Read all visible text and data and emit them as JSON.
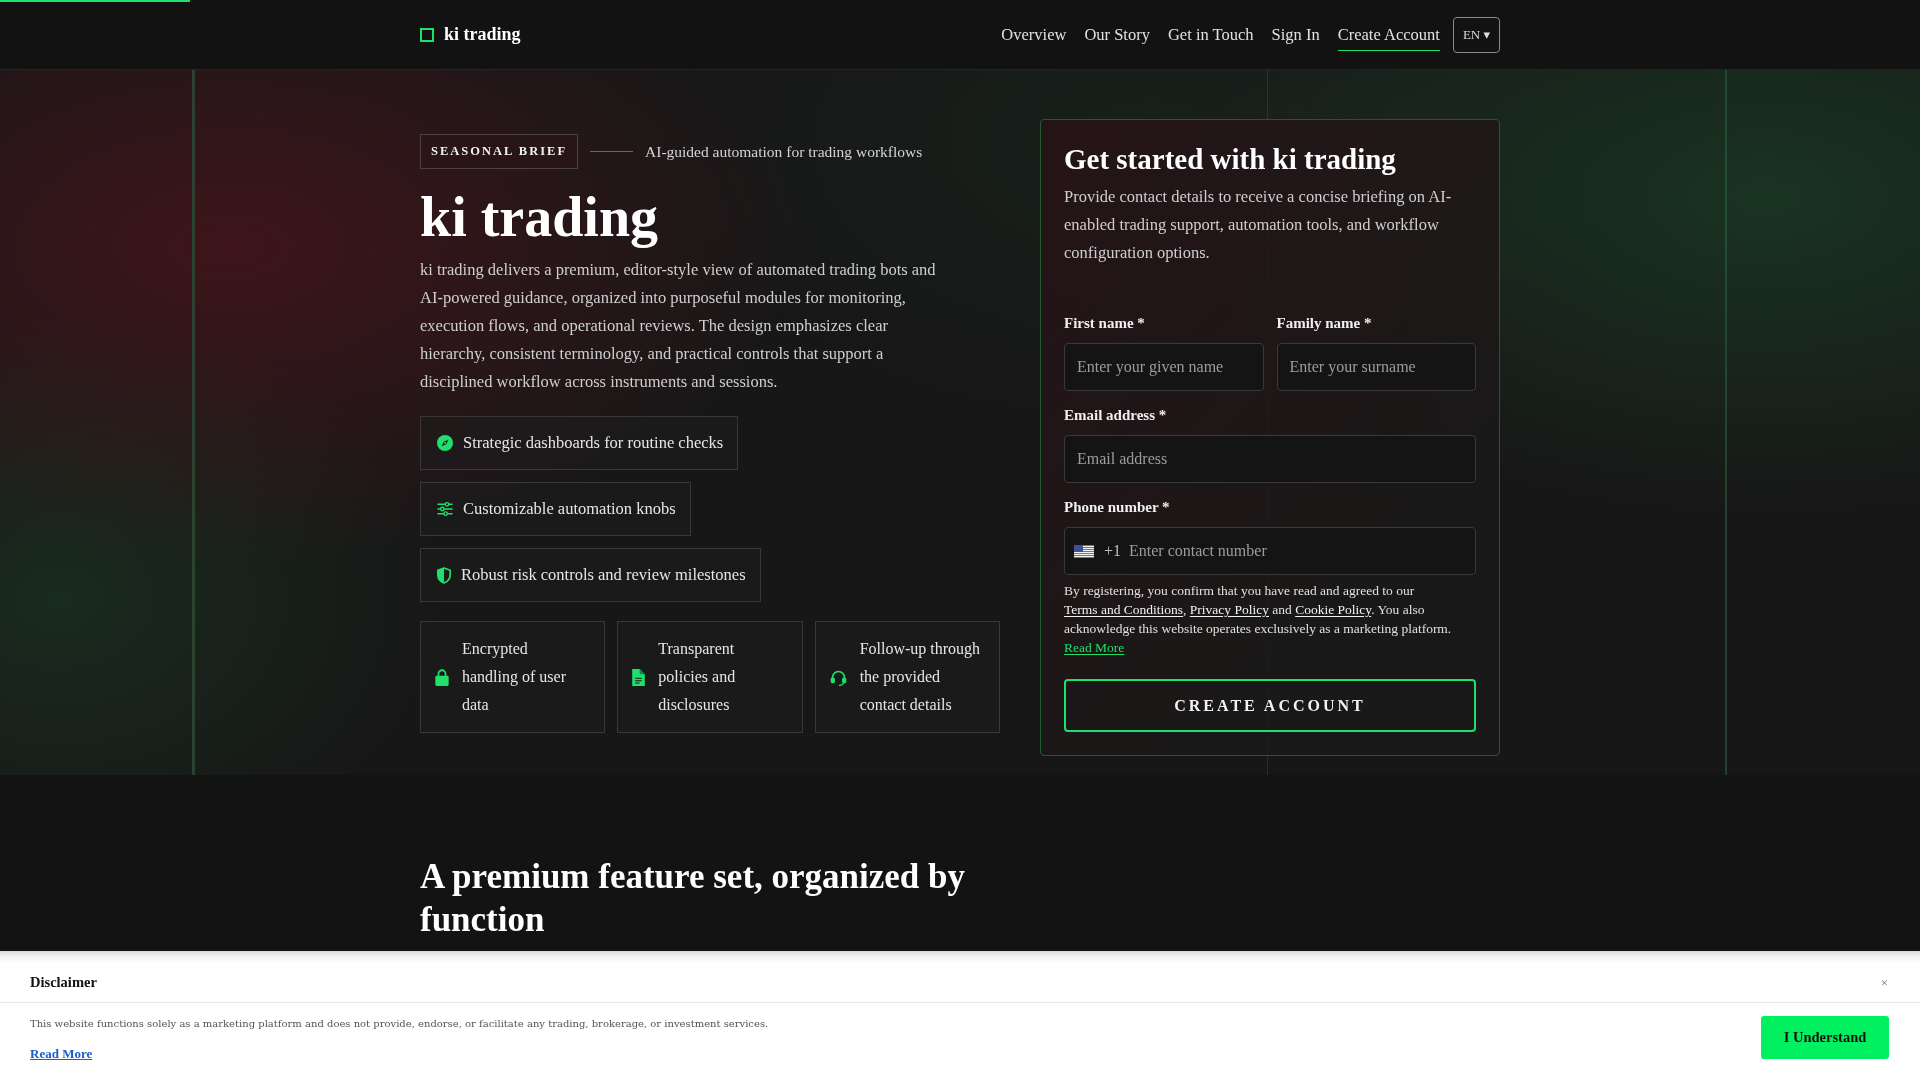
{
  "header": {
    "logo": "ki trading",
    "nav": [
      {
        "label": "Overview",
        "selected": false
      },
      {
        "label": "Our Story",
        "selected": false
      },
      {
        "label": "Get in Touch",
        "selected": false
      },
      {
        "label": "Sign In",
        "selected": false
      },
      {
        "label": "Create Account",
        "selected": true
      }
    ],
    "language": "EN ▾"
  },
  "hero": {
    "badge": "SEASONAL BRIEF",
    "tagline": "AI-guided automation for trading workflows",
    "title": "ki trading",
    "description": "ki trading delivers a premium, editor-style view of automated trading bots and AI-powered guidance, organized into purposeful modules for monitoring, execution flows, and operational reviews. The design emphasizes clear hierarchy, consistent terminology, and practical controls that support a disciplined workflow across instruments and sessions.",
    "highlights": [
      "Strategic dashboards for routine checks",
      "Customizable automation knobs",
      "Robust risk controls and review milestones"
    ],
    "assurances": [
      "Encrypted handling of user data",
      "Transparent policies and disclosures",
      "Follow-up through the provided contact details"
    ]
  },
  "signup_form": {
    "title": "Get started with ki trading",
    "description": "Provide contact details to receive a concise briefing on AI-enabled trading support, automation tools, and workflow configuration options.",
    "name_fields": [
      {
        "label": "First name *",
        "placeholder": "Enter your given name"
      },
      {
        "label": "Family name *",
        "placeholder": "Enter your surname"
      }
    ],
    "email_field": {
      "label": "Email address *",
      "placeholder": "Email address"
    },
    "phone_field": {
      "label": "Phone number *",
      "dial_code": "+1",
      "placeholder": "Enter contact number"
    },
    "consent": [
      {
        "kind": "text",
        "text": "By registering, you confirm that you have read and agreed to our "
      },
      {
        "kind": "link",
        "text": "Terms and Conditions"
      },
      {
        "kind": "text",
        "text": ", "
      },
      {
        "kind": "link",
        "text": "Privacy Policy"
      },
      {
        "kind": "text",
        "text": " and "
      },
      {
        "kind": "link",
        "text": "Cookie Policy"
      },
      {
        "kind": "text",
        "text": ". You also acknowledge this website operates exclusively as a marketing platform. "
      },
      {
        "kind": "accent_link",
        "text": "Read More"
      }
    ],
    "submit": "CREATE ACCOUNT"
  },
  "features_section": {
    "heading": "A premium feature set, organized by function"
  },
  "disclaimer": {
    "title": "Disclaimer",
    "close": "×",
    "text": "This website functions solely as a marketing platform and does not provide, endorse, or facilitate any trading, brokerage, or investment services.",
    "link": "Read More",
    "button": "I Understand"
  }
}
